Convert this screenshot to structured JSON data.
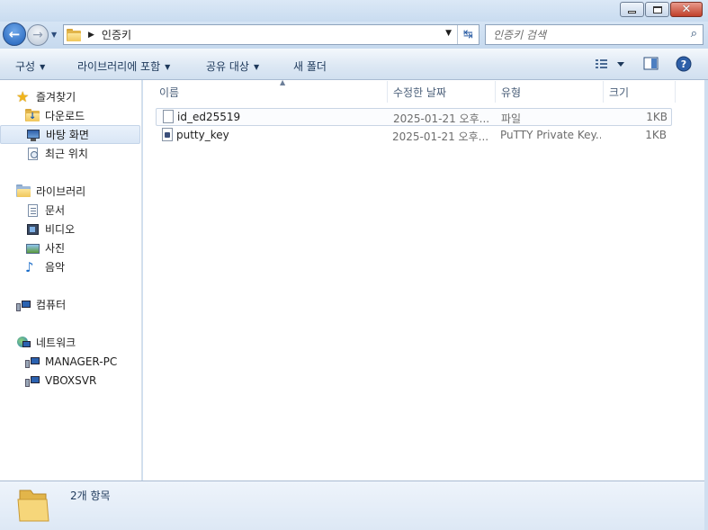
{
  "window": {
    "minimize_glyph": "",
    "close_glyph": "✕"
  },
  "nav": {
    "back_glyph": "←",
    "forward_glyph": "→",
    "address": {
      "breadcrumb": "인증키"
    },
    "search": {
      "placeholder": "인증키 검색"
    }
  },
  "toolbar": {
    "organize": "구성",
    "include_in_library": "라이브러리에 포함",
    "share_with": "공유 대상",
    "new_folder": "새 폴더"
  },
  "sidebar": {
    "favorites": {
      "label": "즐겨찾기",
      "items": [
        {
          "label": "다운로드",
          "icon": "downloads-folder-icon"
        },
        {
          "label": "바탕 화면",
          "icon": "desktop-icon",
          "selected": true
        },
        {
          "label": "최근 위치",
          "icon": "recent-places-icon"
        }
      ]
    },
    "libraries": {
      "label": "라이브러리",
      "items": [
        {
          "label": "문서",
          "icon": "documents-icon"
        },
        {
          "label": "비디오",
          "icon": "videos-icon"
        },
        {
          "label": "사진",
          "icon": "pictures-icon"
        },
        {
          "label": "음악",
          "icon": "music-icon"
        }
      ]
    },
    "computer": {
      "label": "컴퓨터"
    },
    "network": {
      "label": "네트워크",
      "items": [
        {
          "label": "MANAGER-PC",
          "icon": "network-computer-icon"
        },
        {
          "label": "VBOXSVR",
          "icon": "network-computer-icon"
        }
      ]
    }
  },
  "columns": {
    "name": "이름",
    "date_modified": "수정한 날짜",
    "type": "유형",
    "size": "크기"
  },
  "files": [
    {
      "name": "id_ed25519",
      "date": "2025-01-21 오후...",
      "type": "파일",
      "size": "1KB",
      "icon": "file-icon"
    },
    {
      "name": "putty_key",
      "date": "2025-01-21 오후...",
      "type": "PuTTY Private Key...",
      "size": "1KB",
      "icon": "putty-key-file-icon"
    }
  ],
  "details": {
    "item_count": "2개 항목"
  }
}
